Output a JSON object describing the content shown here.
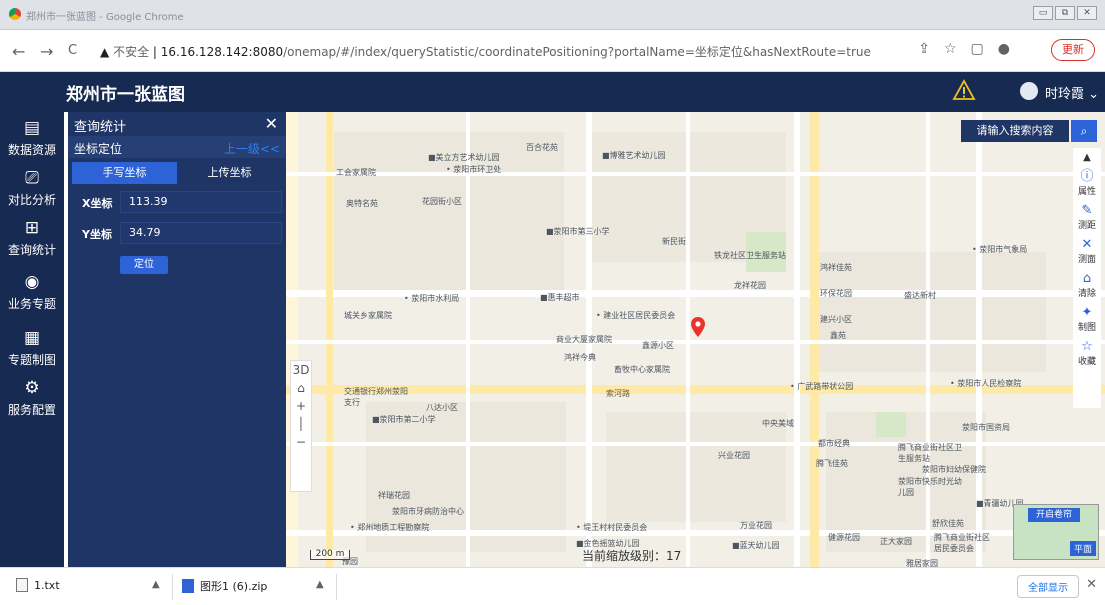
{
  "browser": {
    "tab_title": "郑州市一张蓝图 - Google Chrome",
    "url_warning": "不安全",
    "url_host": "16.16.128.142:8080",
    "url_path": "/onemap/#/index/queryStatistic/coordinatePositioning?portalName=坐标定位&hasNextRoute=true",
    "update_label": "更新",
    "back": "←",
    "forward": "→",
    "reload": "C"
  },
  "header": {
    "title": "郑州市一张蓝图",
    "user_name": "时玲霞"
  },
  "sidebar": {
    "items": [
      {
        "label": "数据资源",
        "icon": "document-icon"
      },
      {
        "label": "对比分析",
        "icon": "compare-icon"
      },
      {
        "label": "查询统计",
        "icon": "grid-icon"
      },
      {
        "label": "业务专题",
        "icon": "globe-icon"
      },
      {
        "label": "专题制图",
        "icon": "map-make-icon"
      },
      {
        "label": "服务配置",
        "icon": "settings-icon"
      }
    ]
  },
  "panel": {
    "title": "查询统计",
    "subtitle": "坐标定位",
    "back_label": "上一级<<",
    "tabs": [
      "手写坐标",
      "上传坐标"
    ],
    "x_label": "X坐标",
    "x_value": "113.39",
    "y_label": "Y坐标",
    "y_value": "34.79",
    "locate_label": "定位"
  },
  "map": {
    "search_placeholder": "请输入搜索内容",
    "tools": [
      "属性",
      "测距",
      "测面",
      "清除",
      "制图",
      "收藏"
    ],
    "zoom_level_text": "当前缩放级别：17",
    "scale_text": "200 m",
    "minimap_tag": "开启卷帘",
    "minimap_flat": "平面",
    "labels": [
      "■美立方艺术幼儿园",
      "• 荥阳市环卫处",
      "百合花苑",
      "■博雅艺术幼儿园",
      "工会家属院",
      "奥特名苑",
      "花园街小区",
      "■荥阳市第三小学",
      "新民街",
      "铁龙社区卫生服务站",
      "鸿祥佳苑",
      "• 荥阳市气象局",
      "• 荥阳市水利局",
      "■惠丰超市",
      "龙祥花园",
      "环保花园",
      "盛达新村",
      "城关乡家属院",
      "• 建业社区居民委员会",
      "建兴小区",
      "鑫苑",
      "商业大厦家属院",
      "鑫源小区",
      "鸿祥今典",
      "畜牧中心家属院",
      "交通银行郑州荥阳支行",
      "八达小区",
      "索河路",
      "• 广武路带状公园",
      "• 荥阳市人民检察院",
      "■荥阳市第二小学",
      "中央美域",
      "荥阳市国资局",
      "都市经典",
      "腾飞佳苑",
      "兴业花园",
      "腾飞商业街社区卫生服务站",
      "荥阳市妇幼保健院",
      "荥阳市快乐时光幼儿园",
      "祥瑞花园",
      "荥阳市牙病防治中心",
      "■青疆幼儿园",
      "• 郑州地质工程勘察院",
      "• 堤王村村民委员会",
      "万业花园",
      "健源花园",
      "正大家园",
      "■金色摇篮幼儿园",
      "■蓝天幼儿园",
      "腾飞商业街社区居民委员会",
      "舒欣佳苑",
      "豫园",
      "雅居家园"
    ]
  },
  "downloads": {
    "items": [
      "1.txt",
      "图形1 (6).zip"
    ],
    "show_all": "全部显示"
  }
}
